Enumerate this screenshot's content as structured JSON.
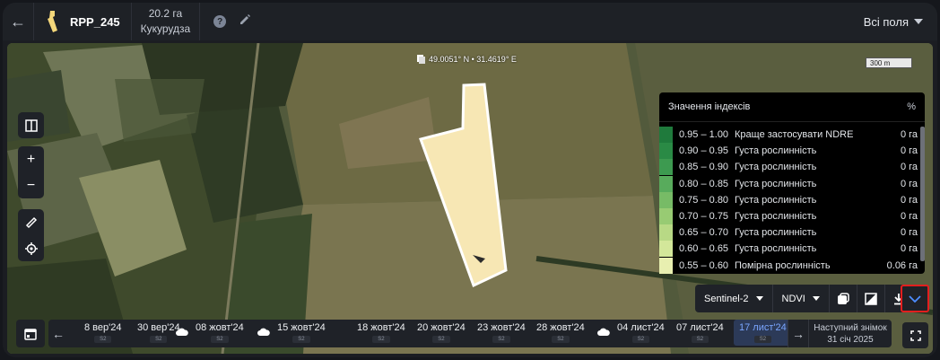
{
  "header": {
    "field_name": "RPP_245",
    "area": "20.2 га",
    "crop": "Кукурудза",
    "help_label": "?",
    "fields_dropdown": "Всі поля"
  },
  "map": {
    "coordinates": "49.0051° N • 31.4619° E",
    "scale_label": "300 m"
  },
  "legend": {
    "title": "Значення індексів",
    "unit_toggle": "%",
    "rows": [
      {
        "range": "0.95 – 1.00",
        "desc": "Краще застосувати NDRE",
        "value": "0 га",
        "color": "#1f7a3c"
      },
      {
        "range": "0.90 – 0.95",
        "desc": "Густа рослинність",
        "value": "0 га",
        "color": "#2a8a45"
      },
      {
        "range": "0.85 – 0.90",
        "desc": "Густа рослинність",
        "value": "0 га",
        "color": "#3d9a50"
      },
      {
        "range": "0.80 – 0.85",
        "desc": "Густа рослинність",
        "value": "0 га",
        "color": "#58ab5c"
      },
      {
        "range": "0.75 – 0.80",
        "desc": "Густа рослинність",
        "value": "0 га",
        "color": "#77bb66"
      },
      {
        "range": "0.70 – 0.75",
        "desc": "Густа рослинність",
        "value": "0 га",
        "color": "#98cb73"
      },
      {
        "range": "0.65 – 0.70",
        "desc": "Густа рослинність",
        "value": "0 га",
        "color": "#b8d985"
      },
      {
        "range": "0.60 – 0.65",
        "desc": "Густа рослинність",
        "value": "0 га",
        "color": "#d3e79a"
      },
      {
        "range": "0.55 – 0.60",
        "desc": "Помірна рослинність",
        "value": "0.06 га",
        "color": "#e8efb0"
      }
    ]
  },
  "toolbar": {
    "satellite": "Sentinel-2",
    "index": "NDVI"
  },
  "timeline": {
    "dates": [
      {
        "label": "8 вер'24",
        "sat": "S2",
        "cloud": false
      },
      {
        "label": "30 вер'24",
        "sat": "S2",
        "cloud": false
      },
      {
        "label": "08 жовт'24",
        "sat": "S2",
        "cloud": true
      },
      {
        "label": "15 жовт'24",
        "sat": "S2",
        "cloud": true
      },
      {
        "label": "18 жовт'24",
        "sat": "S2",
        "cloud": false
      },
      {
        "label": "20 жовт'24",
        "sat": "S2",
        "cloud": false
      },
      {
        "label": "23 жовт'24",
        "sat": "S2",
        "cloud": false
      },
      {
        "label": "28 жовт'24",
        "sat": "S2",
        "cloud": false
      },
      {
        "label": "04 лист'24",
        "sat": "S2",
        "cloud": true
      },
      {
        "label": "07 лист'24",
        "sat": "S2",
        "cloud": false
      },
      {
        "label": "17 лист'24",
        "sat": "S2",
        "cloud": false,
        "selected": true
      }
    ],
    "next_title": "Наступний знімок",
    "next_date": "31 січ 2025"
  }
}
